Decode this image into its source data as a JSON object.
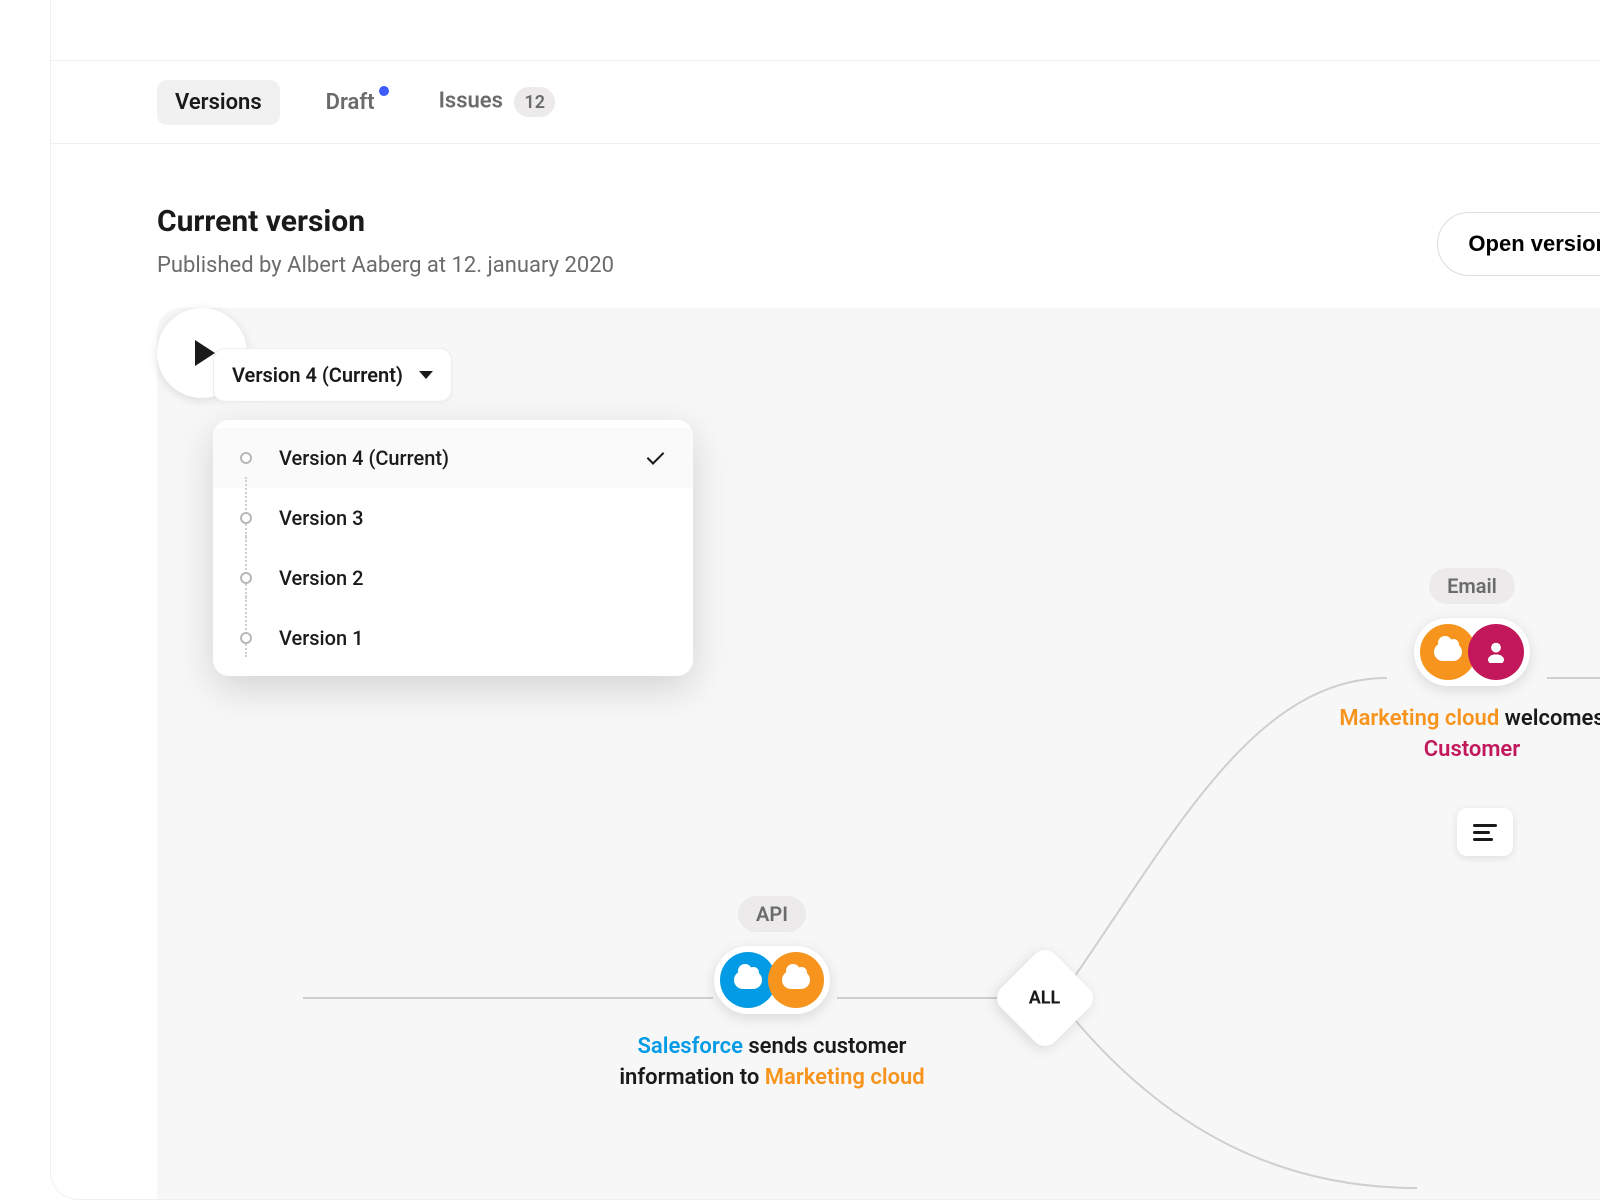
{
  "tabs": {
    "versions": "Versions",
    "draft": "Draft",
    "issues": "Issues",
    "issues_count": "12"
  },
  "header": {
    "title": "Current version",
    "subtitle": "Published by Albert Aaberg at 12. january 2020",
    "open_button": "Open version"
  },
  "version_select": {
    "current_label": "Version 4 (Current)",
    "options": [
      {
        "label": "Version 4 (Current)",
        "selected": true
      },
      {
        "label": "Version 3",
        "selected": false
      },
      {
        "label": "Version 2",
        "selected": false
      },
      {
        "label": "Version 1",
        "selected": false
      }
    ]
  },
  "flow": {
    "decision_label": "ALL",
    "api_node": {
      "badge": "API",
      "caption_pre": "Salesforce",
      "caption_mid": " sends customer information to ",
      "caption_post": "Marketing cloud"
    },
    "email_node": {
      "badge": "Email",
      "caption_pre": "Marketing cloud",
      "caption_mid": " welcomes ",
      "caption_post": "Customer"
    }
  },
  "colors": {
    "blue": "#039be5",
    "orange": "#f7941d",
    "magenta": "#c2185b",
    "accent_dot": "#3d5cff"
  }
}
